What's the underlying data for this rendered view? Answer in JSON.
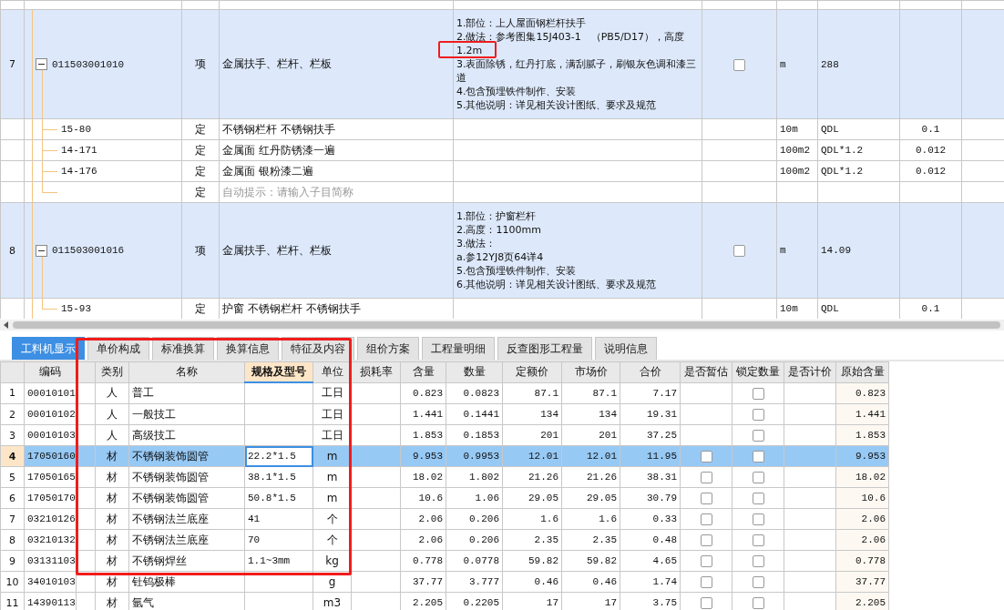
{
  "bill_table": {
    "rows": [
      {
        "number": "7",
        "code": "011503001010",
        "type": "项",
        "name": "金属扶手、栏杆、栏板",
        "features": [
          "1.部位：上人屋面钢栏杆扶手",
          "2.做法：参考图集15J403-1　（PB5/D17），高度",
          "1.2m",
          "3.表面除锈，红丹打底，满刮腻子，刷银灰色调和漆三道",
          "4.包含预埋铁件制作、安装",
          "5.其他说明：详见相关设计图纸、要求及规范"
        ],
        "checked": false,
        "unit": "m",
        "expression": "288",
        "expanded": true,
        "children": [
          {
            "code": "15-80",
            "type": "定",
            "name": "不锈钢栏杆 不锈钢扶手",
            "unit": "10m",
            "expression": "QDL",
            "quantity": "0.1"
          },
          {
            "code": "14-171",
            "type": "定",
            "name": "金属面 红丹防锈漆一遍",
            "unit": "100m2",
            "expression": "QDL*1.2",
            "quantity": "0.012"
          },
          {
            "code": "14-176",
            "type": "定",
            "name": "金属面 银粉漆二遍",
            "unit": "100m2",
            "expression": "QDL*1.2",
            "quantity": "0.012"
          },
          {
            "type": "定",
            "placeholder": "自动提示：请输入子目简称"
          }
        ]
      },
      {
        "number": "8",
        "code": "011503001016",
        "type": "项",
        "name": "金属扶手、栏杆、栏板",
        "features": [
          "1.部位：护窗栏杆",
          "2.高度：1100mm",
          "3.做法：",
          "a.参12YJ8页64详4",
          "5.包含预埋铁件制作、安装",
          "6.其他说明：详见相关设计图纸、要求及规范"
        ],
        "checked": false,
        "unit": "m",
        "expression": "14.09",
        "expanded": true,
        "children": [
          {
            "code": "15-93",
            "type": "定",
            "name": "护窗 不锈钢栏杆 不锈钢扶手",
            "unit": "10m",
            "expression": "QDL",
            "quantity": "0.1"
          }
        ]
      }
    ]
  },
  "tabs": [
    {
      "label": "工料机显示",
      "selected": true
    },
    {
      "label": "单价构成",
      "selected": false
    },
    {
      "label": "标准换算",
      "selected": false
    },
    {
      "label": "换算信息",
      "selected": false
    },
    {
      "label": "特征及内容",
      "selected": false
    },
    {
      "label": "组价方案",
      "selected": false
    },
    {
      "label": "工程量明细",
      "selected": false
    },
    {
      "label": "反查图形工程量",
      "selected": false
    },
    {
      "label": "说明信息",
      "selected": false
    }
  ],
  "resource_table": {
    "columns": [
      {
        "label": "编码",
        "active": false
      },
      {
        "label": "类别",
        "active": false
      },
      {
        "label": "名称",
        "active": false
      },
      {
        "label": "规格及型号",
        "active": true
      },
      {
        "label": "单位",
        "active": false
      },
      {
        "label": "损耗率",
        "active": false
      },
      {
        "label": "含量",
        "active": false
      },
      {
        "label": "数量",
        "active": false
      },
      {
        "label": "定额价",
        "active": false
      },
      {
        "label": "市场价",
        "active": false
      },
      {
        "label": "合价",
        "active": false
      },
      {
        "label": "是否暂估",
        "active": false
      },
      {
        "label": "锁定数量",
        "active": false
      },
      {
        "label": "是否计价",
        "active": false
      },
      {
        "label": "原始含量",
        "active": false
      }
    ],
    "rows": [
      {
        "number": "1",
        "code": "00010101",
        "category": "人",
        "name": "普工",
        "unit": "工日",
        "content": "0.823",
        "quantity": "0.0823",
        "quota_price": "87.1",
        "market_price": "87.1",
        "total": "7.17",
        "locked": false,
        "original": "0.823",
        "selected": false
      },
      {
        "number": "2",
        "code": "00010102",
        "category": "人",
        "name": "一般技工",
        "unit": "工日",
        "content": "1.441",
        "quantity": "0.1441",
        "quota_price": "134",
        "market_price": "134",
        "total": "19.31",
        "locked": false,
        "original": "1.441",
        "selected": false
      },
      {
        "number": "3",
        "code": "00010103",
        "category": "人",
        "name": "高级技工",
        "unit": "工日",
        "content": "1.853",
        "quantity": "0.1853",
        "quota_price": "201",
        "market_price": "201",
        "total": "37.25",
        "locked": false,
        "original": "1.853",
        "selected": false
      },
      {
        "number": "4",
        "code": "17050160",
        "category": "材",
        "name": "不锈钢装饰圆管",
        "spec": "22.2*1.5",
        "unit": "m",
        "content": "9.953",
        "quantity": "0.9953",
        "quota_price": "12.01",
        "market_price": "12.01",
        "total": "11.95",
        "estimate": false,
        "locked": false,
        "original": "9.953",
        "selected": true
      },
      {
        "number": "5",
        "code": "17050165",
        "category": "材",
        "name": "不锈钢装饰圆管",
        "spec": "38.1*1.5",
        "unit": "m",
        "content": "18.02",
        "quantity": "1.802",
        "quota_price": "21.26",
        "market_price": "21.26",
        "total": "38.31",
        "estimate": false,
        "locked": false,
        "original": "18.02",
        "selected": false
      },
      {
        "number": "6",
        "code": "17050170",
        "category": "材",
        "name": "不锈钢装饰圆管",
        "spec": "50.8*1.5",
        "unit": "m",
        "content": "10.6",
        "quantity": "1.06",
        "quota_price": "29.05",
        "market_price": "29.05",
        "total": "30.79",
        "estimate": false,
        "locked": false,
        "original": "10.6",
        "selected": false
      },
      {
        "number": "7",
        "code": "03210126",
        "category": "材",
        "name": "不锈钢法兰底座",
        "spec": "41",
        "unit": "个",
        "content": "2.06",
        "quantity": "0.206",
        "quota_price": "1.6",
        "market_price": "1.6",
        "total": "0.33",
        "estimate": false,
        "locked": false,
        "original": "2.06",
        "selected": false
      },
      {
        "number": "8",
        "code": "03210132",
        "category": "材",
        "name": "不锈钢法兰底座",
        "spec": "70",
        "unit": "个",
        "content": "2.06",
        "quantity": "0.206",
        "quota_price": "2.35",
        "market_price": "2.35",
        "total": "0.48",
        "estimate": false,
        "locked": false,
        "original": "2.06",
        "selected": false
      },
      {
        "number": "9",
        "code": "03131103",
        "category": "材",
        "name": "不锈钢焊丝",
        "spec": "1.1~3mm",
        "unit": "kg",
        "content": "0.778",
        "quantity": "0.0778",
        "quota_price": "59.82",
        "market_price": "59.82",
        "total": "4.65",
        "estimate": false,
        "locked": false,
        "original": "0.778",
        "selected": false
      },
      {
        "number": "10",
        "code": "34010103",
        "category": "材",
        "name": "钍钨极棒",
        "unit": "g",
        "content": "37.77",
        "quantity": "3.777",
        "quota_price": "0.46",
        "market_price": "0.46",
        "total": "1.74",
        "estimate": false,
        "locked": false,
        "original": "37.77",
        "selected": false
      },
      {
        "number": "11",
        "code": "14390113",
        "category": "材",
        "name": "氩气",
        "unit": "m3",
        "content": "2.205",
        "quantity": "0.2205",
        "quota_price": "17",
        "market_price": "17",
        "total": "3.75",
        "estimate": false,
        "locked": false,
        "original": "2.205",
        "selected": false
      }
    ]
  },
  "annotations": [
    {
      "kind": "red-box"
    },
    {
      "kind": "red-box"
    }
  ]
}
